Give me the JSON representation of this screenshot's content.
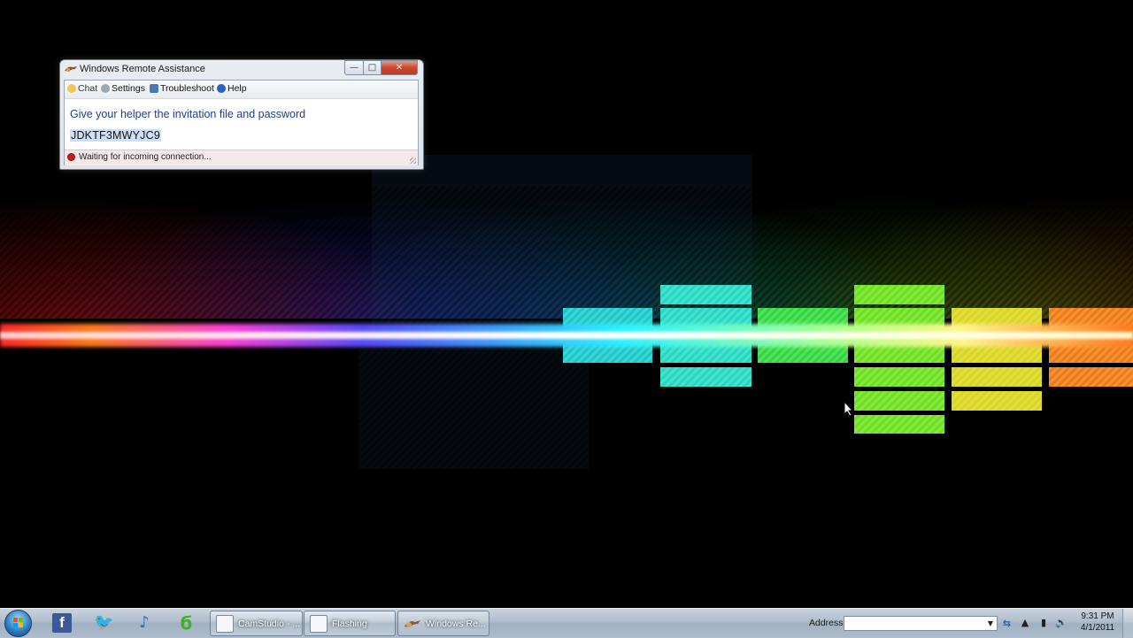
{
  "window": {
    "title": "Windows Remote Assistance",
    "controls": {
      "minimize": "—",
      "maximize": "□",
      "close": "✕"
    },
    "toolbar": {
      "chat": "Chat",
      "settings": "Settings",
      "troubleshoot": "Troubleshoot",
      "help": "Help"
    },
    "message": "Give your helper the invitation file and password",
    "password": "JDKTF3MWYJC9",
    "status": "Waiting for incoming connection..."
  },
  "taskbar": {
    "quick_launch": [
      {
        "name": "facebook-icon",
        "glyph": "f"
      },
      {
        "name": "twitter-icon",
        "glyph": "🐦"
      },
      {
        "name": "itunes-icon",
        "glyph": "♪"
      },
      {
        "name": "green-app-icon",
        "glyph": "ϭ"
      }
    ],
    "buttons": [
      {
        "label": "CamStudio - ..."
      },
      {
        "label": "Flashing"
      },
      {
        "label": "Windows Re..."
      }
    ],
    "address_label": "Address",
    "address_value": "",
    "tray": {
      "show_hidden": "▲",
      "network": "▮",
      "volume": "🔊"
    },
    "clock": {
      "time": "9:31 PM",
      "date": "4/1/2011"
    }
  },
  "colors": {
    "message_text": "#1e3f8c",
    "password_highlight": "#cde0f7",
    "status_bg": "#f4e8ea",
    "close_button": "#c7482e"
  }
}
